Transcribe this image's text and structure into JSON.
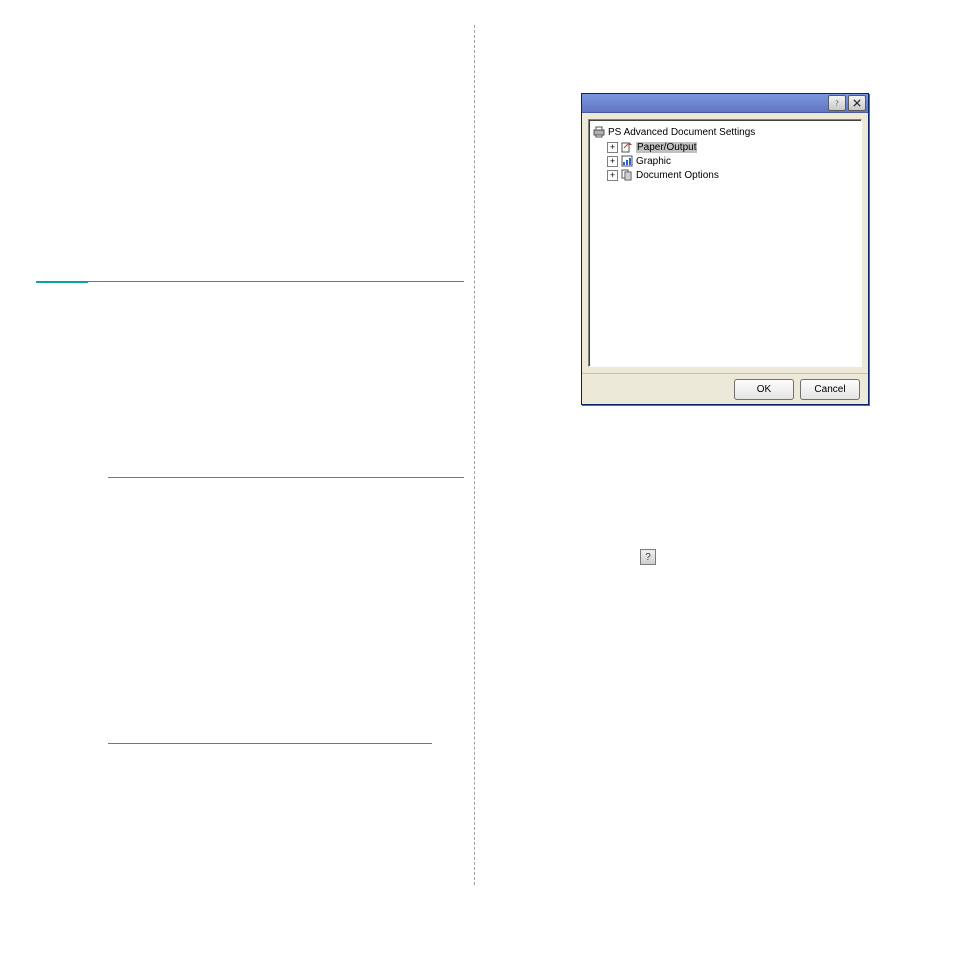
{
  "dialog": {
    "root_label": "PS Advanced Document Settings",
    "nodes": [
      {
        "label": "Paper/Output",
        "selected": true
      },
      {
        "label": "Graphic",
        "selected": false
      },
      {
        "label": "Document Options",
        "selected": false
      }
    ],
    "ok_label": "OK",
    "cancel_label": "Cancel"
  },
  "inline_help_glyph": "?"
}
